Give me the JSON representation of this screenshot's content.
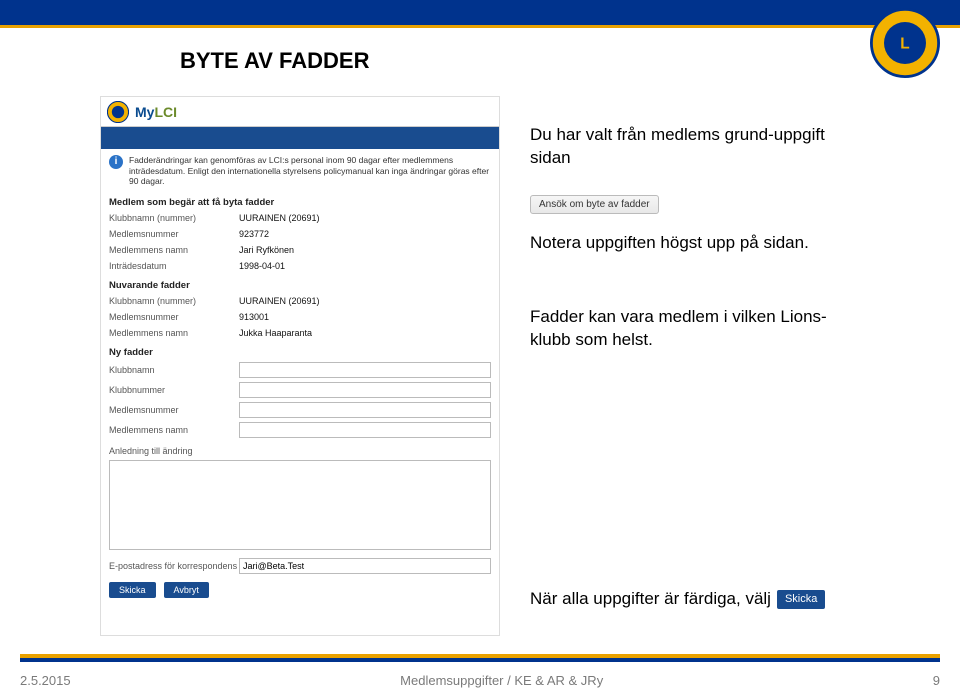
{
  "slide": {
    "title": "BYTE AV FADDER"
  },
  "instructions": {
    "block1": "Du har valt från medlems grund-uppgift sidan",
    "block2": "Notera uppgiften högst upp på sidan.",
    "block3": "Fadder kan vara medlem i vilken Lions-klubb som helst.",
    "block4": "När alla uppgifter är färdiga, välj",
    "skicka_pill": "Skicka",
    "ansok_button": "Ansök om byte av fadder"
  },
  "screenshot": {
    "brand_my": "My",
    "brand_lci": "LCI",
    "info_text": "Fadderändringar kan genomföras av LCI:s personal inom 90 dagar efter medlemmens inträdesdatum. Enligt den internationella styrelsens policymanual kan inga ändringar göras efter 90 dagar.",
    "section_request_heading": "Medlem som begär att få byta fadder",
    "section_current_heading": "Nuvarande fadder",
    "section_new_heading": "Ny fadder",
    "labels": {
      "klubbnamn_num": "Klubbnamn (nummer)",
      "medlemsnummer": "Medlemsnummer",
      "medlemmens_namn": "Medlemmens namn",
      "intradesdatum": "Inträdesdatum",
      "klubbnamn": "Klubbnamn",
      "klubbnummer": "Klubbnummer",
      "anledning": "Anledning till ändring",
      "epost": "E-postadress för korrespondens"
    },
    "member": {
      "klubbnamn_num": "UURAINEN (20691)",
      "medlemsnummer": "923772",
      "medlemmens_namn": "Jari Ryfkönen",
      "intradesdatum": "1998-04-01"
    },
    "current_fadder": {
      "klubbnamn_num": "UURAINEN (20691)",
      "medlemsnummer": "913001",
      "medlemmens_namn": "Jukka Haaparanta"
    },
    "new_fadder": {
      "klubbnamn": "",
      "klubbnummer": "",
      "medlemsnummer": "",
      "medlemmens_namn": ""
    },
    "epost_value": "Jari@Beta.Test",
    "buttons": {
      "skicka": "Skicka",
      "avbryt": "Avbryt"
    }
  },
  "footer": {
    "date": "2.5.2015",
    "center": "Medlemsuppgifter / KE & AR & JRy",
    "page": "9"
  }
}
